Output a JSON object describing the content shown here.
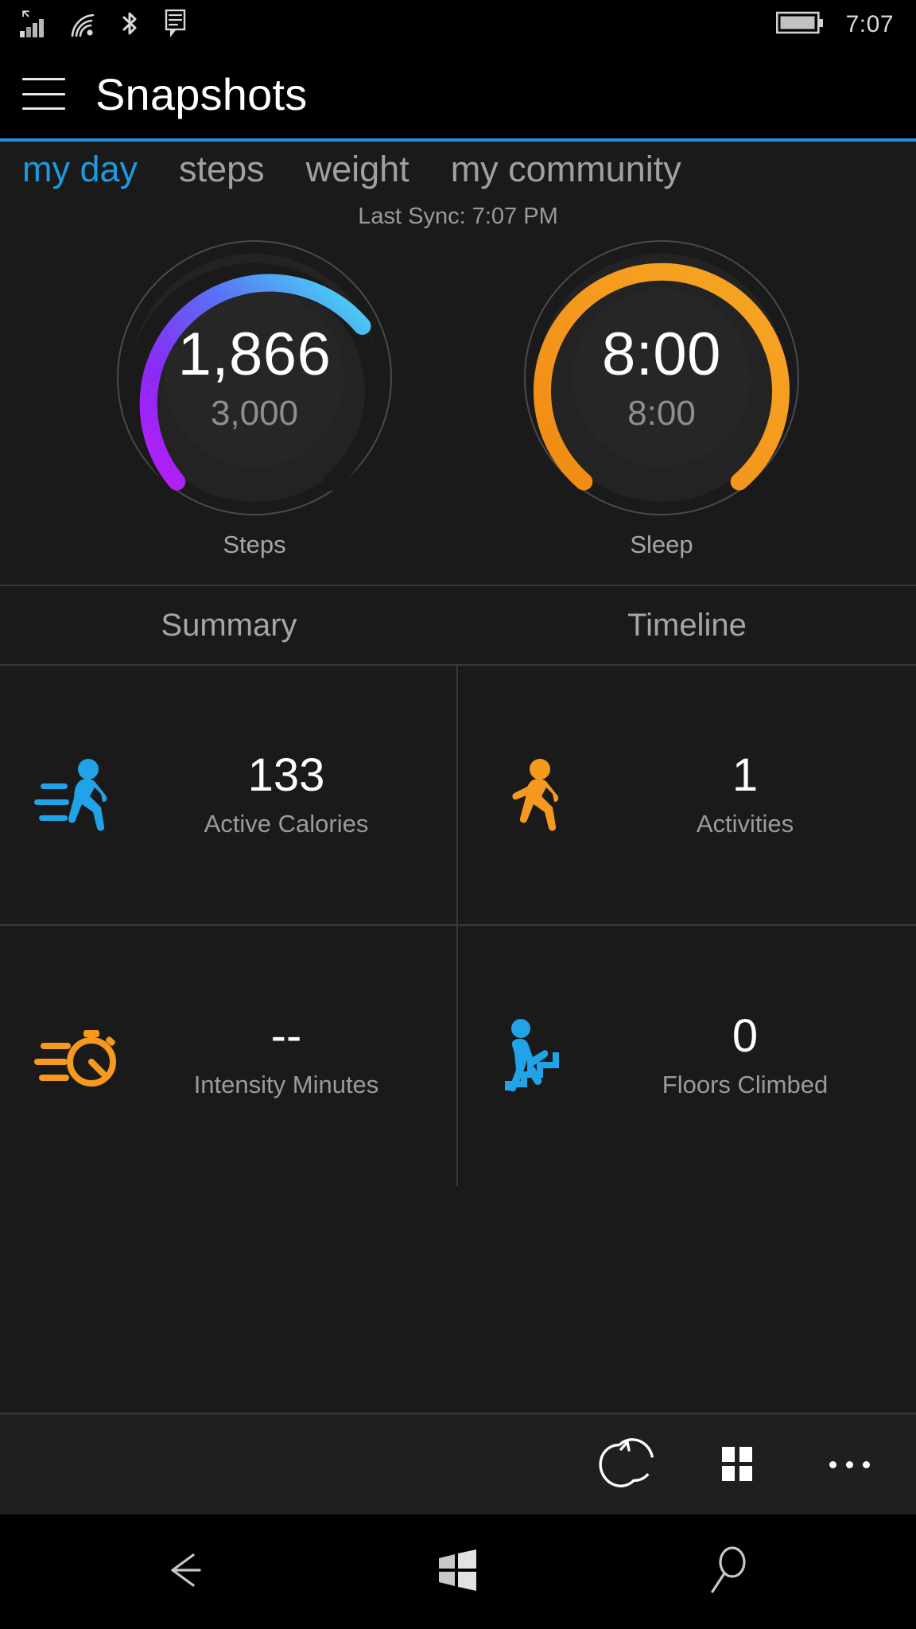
{
  "statusbar": {
    "time": "7:07",
    "icons": [
      "cellular-signal-icon",
      "wifi-icon",
      "bluetooth-icon",
      "sms-icon",
      "battery-icon"
    ]
  },
  "header": {
    "title": "Snapshots",
    "menu_icon": "hamburger-menu-icon",
    "accent_color": "#1e90d8"
  },
  "pivot": {
    "tabs": [
      {
        "label": "my day",
        "active": true
      },
      {
        "label": "steps",
        "active": false
      },
      {
        "label": "weight",
        "active": false
      },
      {
        "label": "my community",
        "active": false
      }
    ],
    "active_color": "#1e9ae0",
    "inactive_color": "#a0a0a0"
  },
  "sync": {
    "text": "Last Sync: 7:07 PM"
  },
  "rings": [
    {
      "key": "steps",
      "label": "Steps",
      "value": "1,866",
      "goal": "3,000",
      "progress": 0.622,
      "watermark": "footprints-icon",
      "gradient_from": "#a21ef0",
      "gradient_mid": "#5a5cf5",
      "gradient_to": "#46dcf0"
    },
    {
      "key": "sleep",
      "label": "Sleep",
      "value": "8:00",
      "goal": "8:00",
      "progress": 1.0,
      "watermark": "zzz-sleep-icon",
      "gradient_from": "#f29220",
      "gradient_mid": "#f59a1f",
      "gradient_to": "#f5a623"
    }
  ],
  "section_tabs": [
    {
      "label": "Summary"
    },
    {
      "label": "Timeline"
    }
  ],
  "stats": [
    {
      "icon": "running-person-icon",
      "icon_color": "#21a3e8",
      "value": "133",
      "label": "Active Calories"
    },
    {
      "icon": "running-person-icon",
      "icon_color": "#f59a1f",
      "value": "1",
      "label": "Activities"
    },
    {
      "icon": "stopwatch-icon",
      "icon_color": "#f59a1f",
      "value": "--",
      "label": "Intensity Minutes"
    },
    {
      "icon": "stairs-climbing-icon",
      "icon_color": "#21a3e8",
      "value": "0",
      "label": "Floors Climbed"
    }
  ],
  "appbar": {
    "buttons": [
      {
        "name": "sync-refresh-button",
        "icon": "refresh-icon"
      },
      {
        "name": "tiles-button",
        "icon": "grid-tiles-icon"
      },
      {
        "name": "more-button",
        "icon": "ellipsis-icon"
      }
    ]
  },
  "navbar": {
    "buttons": [
      {
        "name": "back-button",
        "icon": "back-arrow-icon"
      },
      {
        "name": "start-button",
        "icon": "windows-logo-icon"
      },
      {
        "name": "search-button",
        "icon": "search-icon"
      }
    ]
  }
}
